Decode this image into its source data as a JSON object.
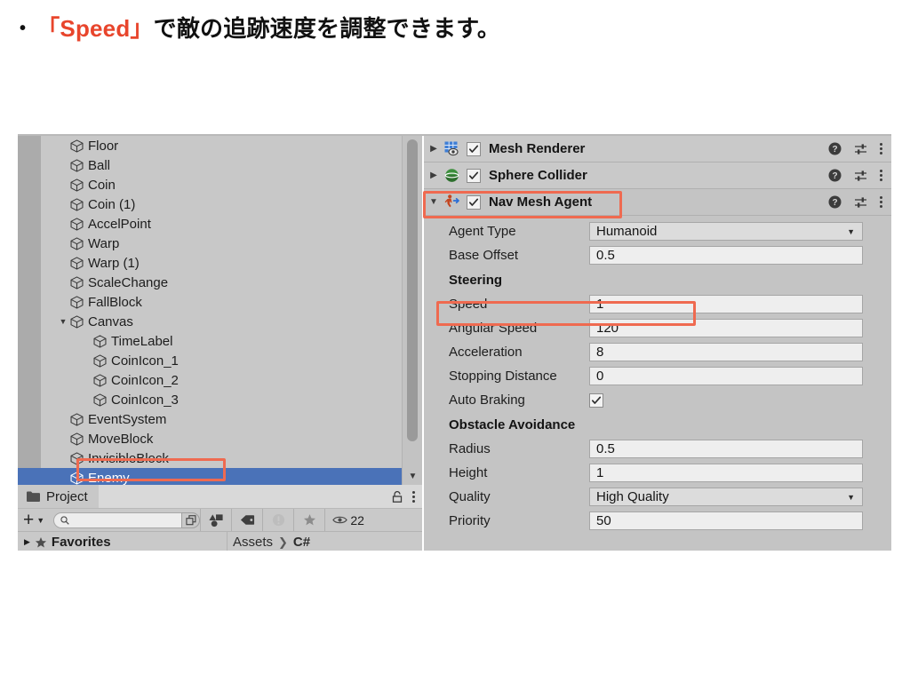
{
  "slide": {
    "bullet": "•",
    "heading_accent": "「Speed」",
    "heading_rest": "で敵の追跡速度を調整できます。",
    "accent_color": "#e8452c"
  },
  "hierarchy": {
    "items": [
      {
        "label": "Floor",
        "indent": 1,
        "twisty": "",
        "selected": false
      },
      {
        "label": "Ball",
        "indent": 1,
        "twisty": "",
        "selected": false
      },
      {
        "label": "Coin",
        "indent": 1,
        "twisty": "",
        "selected": false
      },
      {
        "label": "Coin (1)",
        "indent": 1,
        "twisty": "",
        "selected": false
      },
      {
        "label": "AccelPoint",
        "indent": 1,
        "twisty": "",
        "selected": false
      },
      {
        "label": "Warp",
        "indent": 1,
        "twisty": "",
        "selected": false
      },
      {
        "label": "Warp (1)",
        "indent": 1,
        "twisty": "",
        "selected": false
      },
      {
        "label": "ScaleChange",
        "indent": 1,
        "twisty": "",
        "selected": false
      },
      {
        "label": "FallBlock",
        "indent": 1,
        "twisty": "",
        "selected": false
      },
      {
        "label": "Canvas",
        "indent": 1,
        "twisty": "▼",
        "selected": false
      },
      {
        "label": "TimeLabel",
        "indent": 2,
        "twisty": "",
        "selected": false
      },
      {
        "label": "CoinIcon_1",
        "indent": 2,
        "twisty": "",
        "selected": false
      },
      {
        "label": "CoinIcon_2",
        "indent": 2,
        "twisty": "",
        "selected": false
      },
      {
        "label": "CoinIcon_3",
        "indent": 2,
        "twisty": "",
        "selected": false
      },
      {
        "label": "EventSystem",
        "indent": 1,
        "twisty": "",
        "selected": false
      },
      {
        "label": "MoveBlock",
        "indent": 1,
        "twisty": "",
        "selected": false
      },
      {
        "label": "InvisibleBlock",
        "indent": 1,
        "twisty": "",
        "selected": false
      },
      {
        "label": "Enemy",
        "indent": 1,
        "twisty": "",
        "selected": true
      }
    ],
    "selection_color": "#4a72b8"
  },
  "project": {
    "tab_label": "Project",
    "search_placeholder": "",
    "search_value": "",
    "add_label": "+",
    "visible_count": "22",
    "favorites_label": "Favorites",
    "breadcrumb": [
      "Assets",
      "C#"
    ],
    "breadcrumb_separator": "❯"
  },
  "inspector": {
    "components": [
      {
        "name": "Mesh Renderer",
        "twisty": "▶",
        "enabled": true,
        "icon": "mesh-renderer-icon",
        "highlighted": false
      },
      {
        "name": "Sphere Collider",
        "twisty": "▶",
        "enabled": true,
        "icon": "sphere-collider-icon",
        "highlighted": false
      },
      {
        "name": "Nav Mesh Agent",
        "twisty": "▼",
        "enabled": true,
        "icon": "nav-mesh-agent-icon",
        "highlighted": true
      }
    ],
    "nav_mesh_agent": {
      "rows": [
        {
          "label": "Agent Type",
          "value": "Humanoid",
          "type": "dropdown",
          "highlighted": false
        },
        {
          "label": "Base Offset",
          "value": "0.5",
          "type": "text",
          "highlighted": false
        }
      ],
      "steering_header": "Steering",
      "steering_rows": [
        {
          "label": "Speed",
          "value": "1",
          "type": "text",
          "highlighted": true
        },
        {
          "label": "Angular Speed",
          "value": "120",
          "type": "text",
          "highlighted": false
        },
        {
          "label": "Acceleration",
          "value": "8",
          "type": "text",
          "highlighted": false
        },
        {
          "label": "Stopping Distance",
          "value": "0",
          "type": "text",
          "highlighted": false
        },
        {
          "label": "Auto Braking",
          "value": "",
          "type": "checkbox",
          "checked": true,
          "highlighted": false
        }
      ],
      "obstacle_header": "Obstacle Avoidance",
      "obstacle_rows": [
        {
          "label": "Radius",
          "value": "0.5",
          "type": "text",
          "highlighted": false
        },
        {
          "label": "Height",
          "value": "1",
          "type": "text",
          "highlighted": false
        },
        {
          "label": "Quality",
          "value": "High Quality",
          "type": "dropdown",
          "highlighted": false
        },
        {
          "label": "Priority",
          "value": "50",
          "type": "text",
          "highlighted": false
        }
      ]
    },
    "annotation_color": "#ef6a50"
  }
}
